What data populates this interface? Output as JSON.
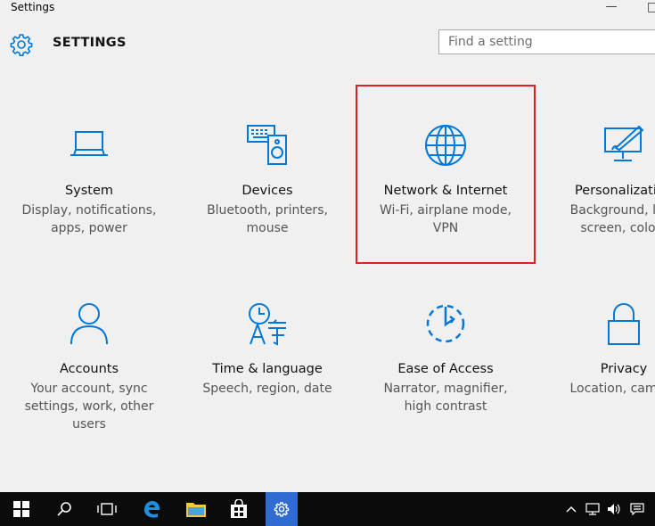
{
  "window": {
    "title": "Settings",
    "minimize_glyph": "—"
  },
  "header": {
    "title": "SETTINGS",
    "icon": "gear-icon"
  },
  "search": {
    "placeholder": "Find a setting"
  },
  "accent_color": "#0078d7",
  "highlight_color": "#e02020",
  "tiles": [
    {
      "name": "System",
      "desc": [
        "Display, notifications,",
        "apps, power"
      ],
      "icon": "laptop-icon"
    },
    {
      "name": "Devices",
      "desc": [
        "Bluetooth, printers,",
        "mouse"
      ],
      "icon": "devices-icon"
    },
    {
      "name": "Network & Internet",
      "desc": [
        "Wi-Fi, airplane mode,",
        "VPN"
      ],
      "icon": "globe-icon",
      "highlighted": true
    },
    {
      "name": "Personalization",
      "desc": [
        "Background, lock",
        "screen, colors"
      ],
      "icon": "personalization-icon"
    },
    {
      "name": "Accounts",
      "desc": [
        "Your account, sync",
        "settings, work, other",
        "users"
      ],
      "icon": "person-icon"
    },
    {
      "name": "Time & language",
      "desc": [
        "Speech, region, date"
      ],
      "icon": "time-language-icon"
    },
    {
      "name": "Ease of Access",
      "desc": [
        "Narrator, magnifier,",
        "high contrast"
      ],
      "icon": "ease-of-access-icon"
    },
    {
      "name": "Privacy",
      "desc": [
        "Location, camera"
      ],
      "icon": "lock-icon"
    }
  ],
  "taskbar": {
    "items": [
      "start-icon",
      "search-icon",
      "task-view-icon",
      "edge-icon",
      "file-explorer-icon",
      "store-icon",
      "settings-icon"
    ],
    "active": "settings-icon",
    "tray": [
      "chevron-up-icon",
      "network-icon",
      "volume-icon",
      "action-center-icon"
    ]
  }
}
